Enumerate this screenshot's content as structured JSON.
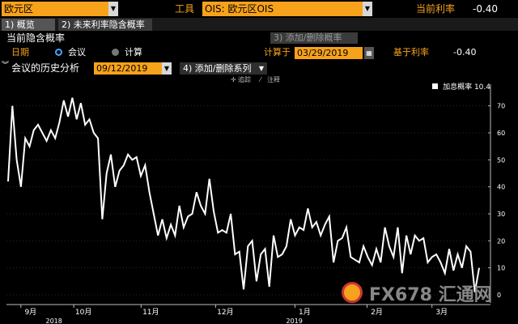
{
  "header": {
    "currency": "欧元区",
    "tool_label": "工具",
    "tool_value": "OIS: 欧元区OIS",
    "current_rate_label": "当前利率",
    "current_rate_value": "-0.40"
  },
  "tabs": [
    {
      "label": "1) 概览"
    },
    {
      "label": "2) 未来利率隐含概率"
    }
  ],
  "section": {
    "title": "当前隐含概率",
    "add_remove": "3) 添加/删除概率"
  },
  "controls": {
    "date_label": "日期",
    "radio_meeting": "会议",
    "radio_calc": "计算",
    "calc_on_label": "计算于",
    "calc_date": "03/29/2019",
    "base_rate_label": "基于利率",
    "base_rate_value": "-0.40"
  },
  "history": {
    "label": "会议的历史分析",
    "date": "09/12/2019",
    "add_series": "4) 添加/删除系列"
  },
  "tools": {
    "track": "追踪",
    "annotate": "注释"
  },
  "chart_data": {
    "type": "line",
    "legend": [
      {
        "name": "加息概率",
        "last": "10.4"
      }
    ],
    "yticks": [
      0,
      10,
      20,
      30,
      40,
      50,
      60,
      70
    ],
    "ylim": [
      -3,
      78
    ],
    "xlabels": [
      {
        "label": "9月",
        "pos": 0.03
      },
      {
        "label": "10月",
        "pos": 0.14
      },
      {
        "label": "11月",
        "pos": 0.28
      },
      {
        "label": "12月",
        "pos": 0.435
      },
      {
        "label": "1月",
        "pos": 0.6
      },
      {
        "label": "2月",
        "pos": 0.75
      },
      {
        "label": "3月",
        "pos": 0.885
      }
    ],
    "years": [
      {
        "label": "2018",
        "pos": 0.25
      },
      {
        "label": "2019",
        "pos": 0.75
      }
    ],
    "series": [
      {
        "values": [
          42,
          70,
          50,
          40,
          58,
          55,
          61,
          63,
          60,
          57,
          61,
          58,
          64,
          72,
          66,
          73,
          65,
          71,
          63,
          65,
          60,
          58,
          28,
          45,
          52,
          40,
          46,
          48,
          52,
          50,
          51,
          44,
          48,
          38,
          30,
          22,
          28,
          21,
          26,
          22,
          33,
          25,
          29,
          30,
          38,
          33,
          30,
          43,
          31,
          23,
          24,
          23,
          30,
          15,
          16,
          2,
          18,
          20,
          5,
          15,
          17,
          3,
          22,
          14,
          15,
          18,
          28,
          22,
          25,
          24,
          32,
          25,
          27,
          22,
          26,
          29,
          12,
          20,
          21,
          25,
          14,
          13,
          12,
          18,
          14,
          11,
          17,
          12,
          25,
          18,
          14,
          25,
          8,
          22,
          15,
          22,
          20,
          21,
          12,
          14,
          15,
          12,
          8,
          17,
          9,
          15,
          10,
          18,
          16,
          1,
          10
        ]
      }
    ]
  },
  "watermark": "FX678 汇通网"
}
